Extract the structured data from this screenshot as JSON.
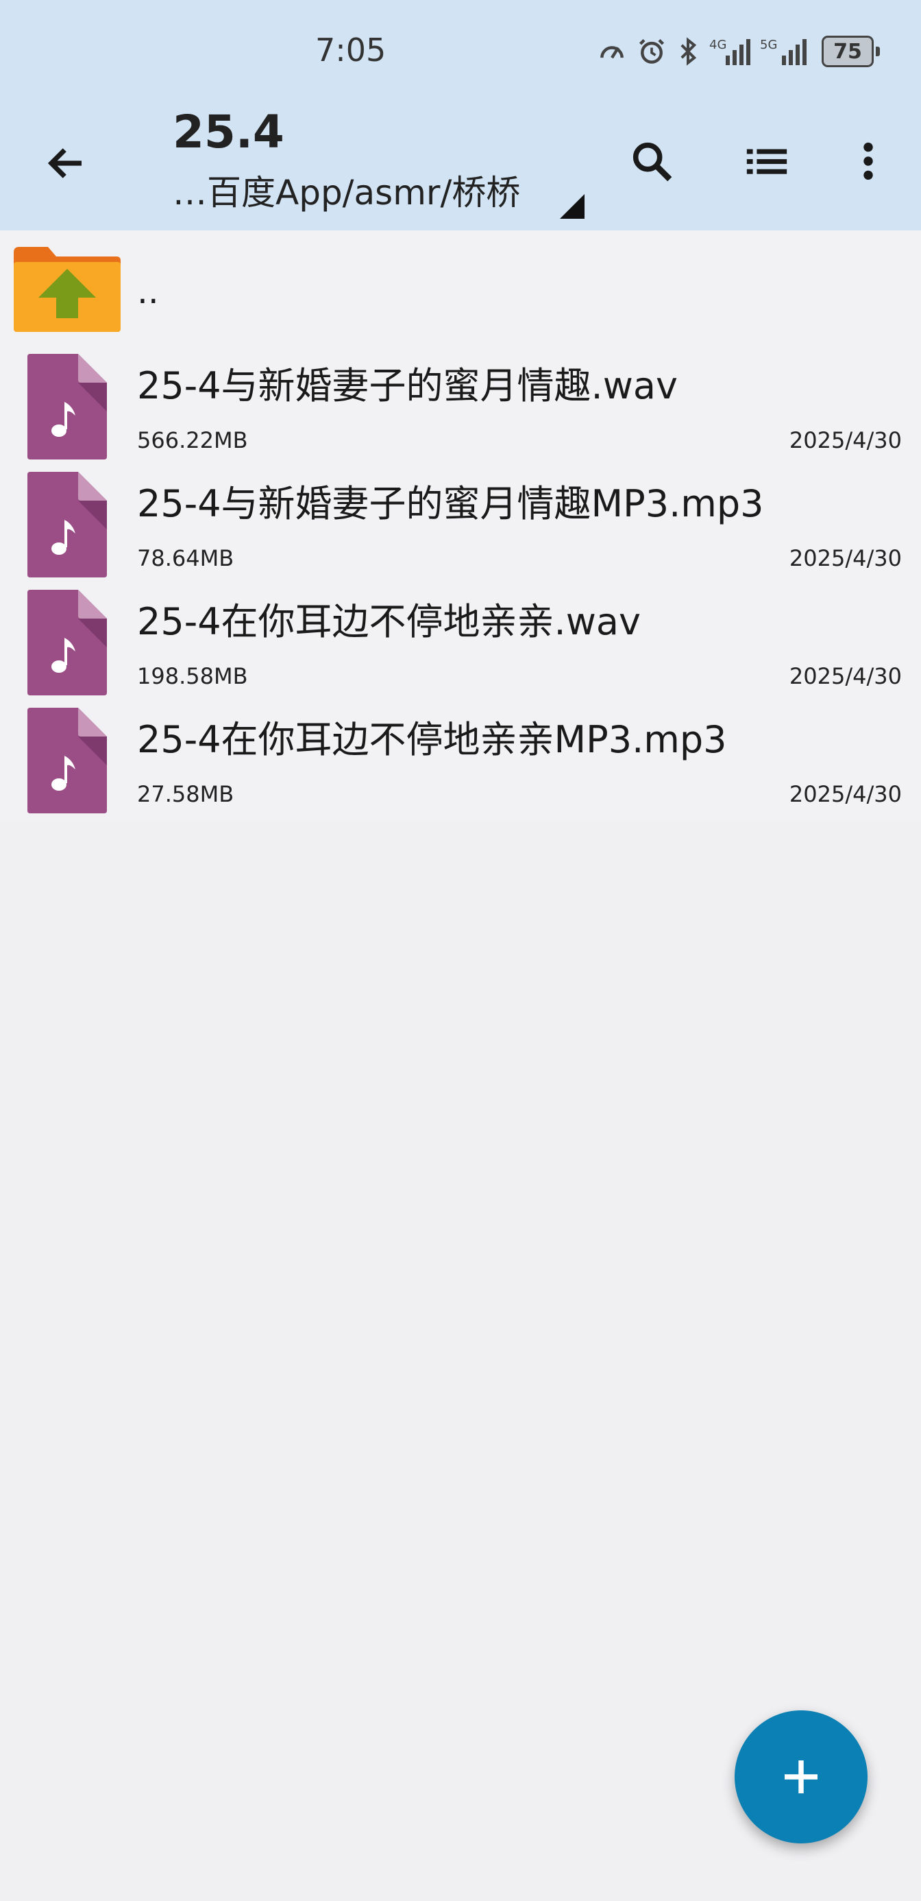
{
  "status_bar": {
    "time": "7:05",
    "battery_level": "75",
    "network_1": "4G",
    "network_2": "5G"
  },
  "toolbar": {
    "title": "25.4",
    "path": "…百度App/asmr/桥桥",
    "icons": [
      "back-arrow-icon",
      "search-icon",
      "list-view-icon",
      "more-vert-icon"
    ]
  },
  "parent_folder": {
    "label": ".."
  },
  "files": [
    {
      "name": "25-4与新婚妻子的蜜月情趣.wav",
      "size": "566.22MB",
      "date": "2025/4/30"
    },
    {
      "name": "25-4与新婚妻子的蜜月情趣MP3.mp3",
      "size": "78.64MB",
      "date": "2025/4/30"
    },
    {
      "name": "25-4在你耳边不停地亲亲.wav",
      "size": "198.58MB",
      "date": "2025/4/30"
    },
    {
      "name": "25-4在你耳边不停地亲亲MP3.mp3",
      "size": "27.58MB",
      "date": "2025/4/30"
    }
  ],
  "colors": {
    "header_bg": "#d2e4f4",
    "audio_file_icon": "#9b4d86",
    "folder": "#f9a825",
    "up_arrow": "#7a9a1a",
    "fab": "#0a80b4"
  }
}
